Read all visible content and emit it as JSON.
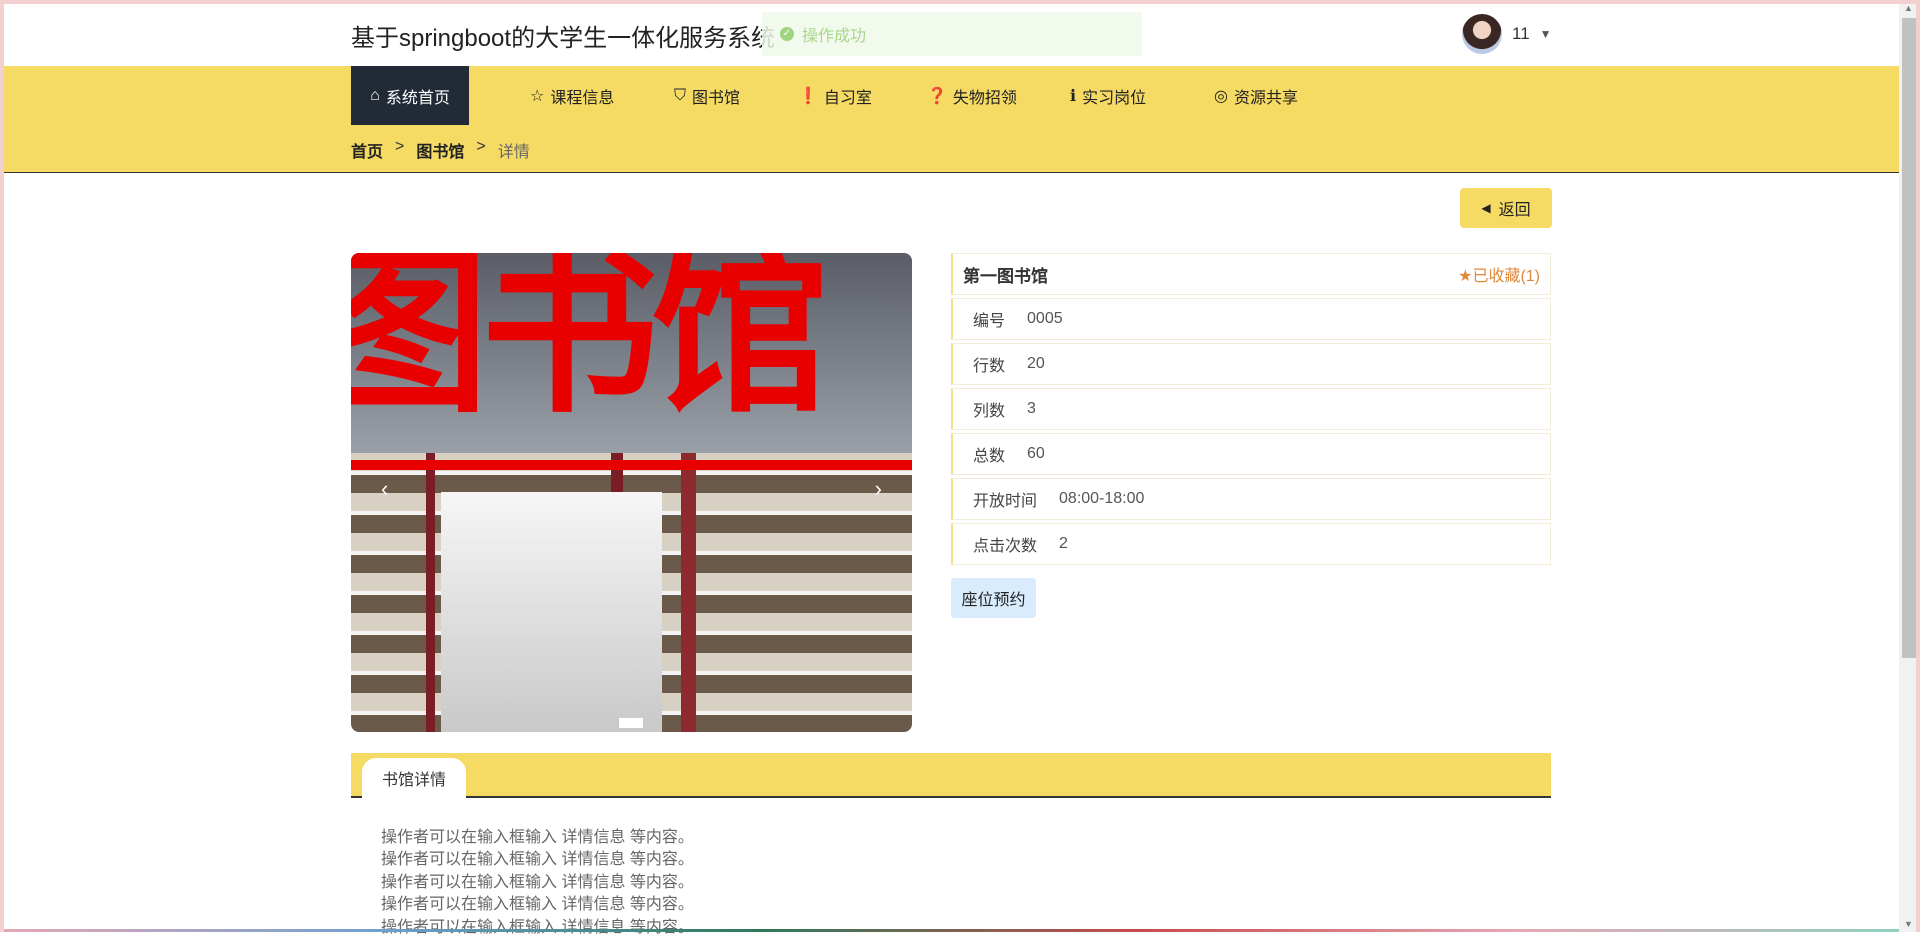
{
  "header": {
    "title": "基于springboot的大学生一体化服务系统",
    "toast": "操作成功",
    "user": "11"
  },
  "nav": [
    {
      "label": "系统首页",
      "icon": "home-icon"
    },
    {
      "label": "课程信息",
      "icon": "star-icon"
    },
    {
      "label": "图书馆",
      "icon": "bag-icon"
    },
    {
      "label": "自习室",
      "icon": "exclamation-icon"
    },
    {
      "label": "失物招领",
      "icon": "question-icon"
    },
    {
      "label": "实习岗位",
      "icon": "info-icon"
    },
    {
      "label": "资源共享",
      "icon": "at-icon"
    }
  ],
  "breadcrumb": {
    "home": "首页",
    "section": "图书馆",
    "current": "详情",
    "sep": ">"
  },
  "back_label": "返回",
  "photo": {
    "sign": "图书馆"
  },
  "detail": {
    "name": "第一图书馆",
    "favorite": "已收藏(1)",
    "rows": [
      {
        "label": "编号",
        "value": "0005"
      },
      {
        "label": "行数",
        "value": "20"
      },
      {
        "label": "列数",
        "value": "3"
      },
      {
        "label": "总数",
        "value": "60"
      },
      {
        "label": "开放时间",
        "value": "08:00-18:00"
      },
      {
        "label": "点击次数",
        "value": "2"
      }
    ],
    "seat_button": "座位预约"
  },
  "tab": "书馆详情",
  "content": [
    "操作者可以在输入框输入  详情信息  等内容。",
    "操作者可以在输入框输入  详情信息  等内容。",
    "操作者可以在输入框输入  详情信息  等内容。",
    "操作者可以在输入框输入  详情信息  等内容。",
    "操作者可以在输入框输入  详情信息  等内容。"
  ]
}
